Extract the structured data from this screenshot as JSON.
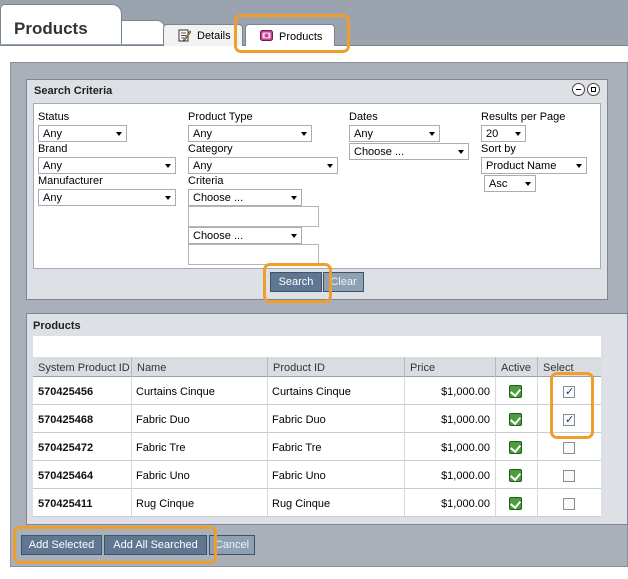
{
  "header": {
    "title": "Products"
  },
  "tabs": [
    {
      "label": "Details",
      "icon": "document-pencil-icon"
    },
    {
      "label": "Products",
      "icon": "product-box-icon"
    }
  ],
  "search_criteria": {
    "title": "Search Criteria",
    "status": {
      "label": "Status",
      "value": "Any"
    },
    "brand": {
      "label": "Brand",
      "value": "Any"
    },
    "manufacturer": {
      "label": "Manufacturer",
      "value": "Any"
    },
    "product_type": {
      "label": "Product Type",
      "value": "Any"
    },
    "category": {
      "label": "Category",
      "value": "Any"
    },
    "criteria": {
      "label": "Criteria",
      "select1": "Choose ...",
      "select2": "Choose ..."
    },
    "dates": {
      "label": "Dates",
      "value": "Any",
      "choose": "Choose ..."
    },
    "results_per_page": {
      "label": "Results per Page",
      "value": "20"
    },
    "sort_by": {
      "label": "Sort by",
      "field": "Product Name",
      "order": "Asc"
    },
    "search_button": "Search",
    "clear_button": "Clear"
  },
  "products": {
    "title": "Products",
    "columns": [
      "System Product ID",
      "Name",
      "Product ID",
      "Price",
      "Active",
      "Select"
    ],
    "rows": [
      {
        "system_id": "570425456",
        "name": "Curtains Cinque",
        "product_id": "Curtains Cinque",
        "price": "$1,000.00",
        "active": true,
        "selected": true
      },
      {
        "system_id": "570425468",
        "name": "Fabric Duo",
        "product_id": "Fabric Duo",
        "price": "$1,000.00",
        "active": true,
        "selected": true
      },
      {
        "system_id": "570425472",
        "name": "Fabric Tre",
        "product_id": "Fabric Tre",
        "price": "$1,000.00",
        "active": true,
        "selected": false
      },
      {
        "system_id": "570425464",
        "name": "Fabric Uno",
        "product_id": "Fabric Uno",
        "price": "$1,000.00",
        "active": true,
        "selected": false
      },
      {
        "system_id": "570425411",
        "name": "Rug Cinque",
        "product_id": "Rug Cinque",
        "price": "$1,000.00",
        "active": true,
        "selected": false
      }
    ]
  },
  "footer": {
    "add_selected": "Add Selected",
    "add_all_searched": "Add All Searched",
    "cancel": "Cancel"
  },
  "colors": {
    "highlight": "#ef9e2c",
    "button": "#5f7792",
    "active_green": "#4a9d3a"
  }
}
